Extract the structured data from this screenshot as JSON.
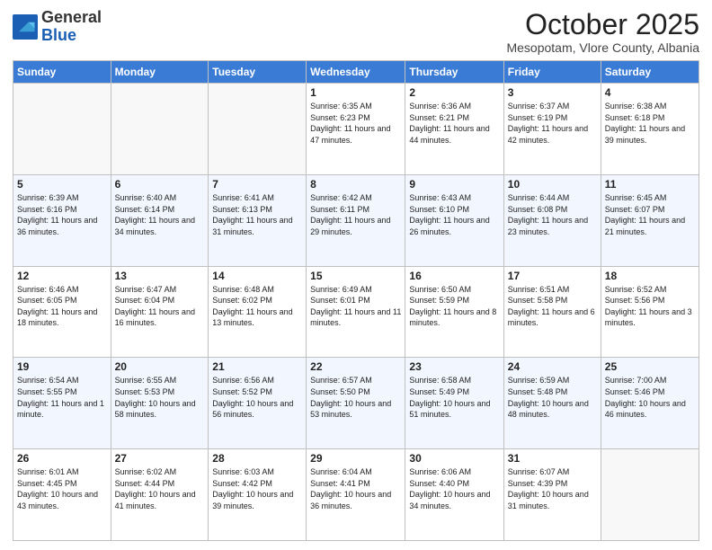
{
  "header": {
    "logo_general": "General",
    "logo_blue": "Blue",
    "month_title": "October 2025",
    "subtitle": "Mesopotam, Vlore County, Albania"
  },
  "days_of_week": [
    "Sunday",
    "Monday",
    "Tuesday",
    "Wednesday",
    "Thursday",
    "Friday",
    "Saturday"
  ],
  "weeks": [
    [
      {
        "day": "",
        "info": ""
      },
      {
        "day": "",
        "info": ""
      },
      {
        "day": "",
        "info": ""
      },
      {
        "day": "1",
        "info": "Sunrise: 6:35 AM\nSunset: 6:23 PM\nDaylight: 11 hours and 47 minutes."
      },
      {
        "day": "2",
        "info": "Sunrise: 6:36 AM\nSunset: 6:21 PM\nDaylight: 11 hours and 44 minutes."
      },
      {
        "day": "3",
        "info": "Sunrise: 6:37 AM\nSunset: 6:19 PM\nDaylight: 11 hours and 42 minutes."
      },
      {
        "day": "4",
        "info": "Sunrise: 6:38 AM\nSunset: 6:18 PM\nDaylight: 11 hours and 39 minutes."
      }
    ],
    [
      {
        "day": "5",
        "info": "Sunrise: 6:39 AM\nSunset: 6:16 PM\nDaylight: 11 hours and 36 minutes."
      },
      {
        "day": "6",
        "info": "Sunrise: 6:40 AM\nSunset: 6:14 PM\nDaylight: 11 hours and 34 minutes."
      },
      {
        "day": "7",
        "info": "Sunrise: 6:41 AM\nSunset: 6:13 PM\nDaylight: 11 hours and 31 minutes."
      },
      {
        "day": "8",
        "info": "Sunrise: 6:42 AM\nSunset: 6:11 PM\nDaylight: 11 hours and 29 minutes."
      },
      {
        "day": "9",
        "info": "Sunrise: 6:43 AM\nSunset: 6:10 PM\nDaylight: 11 hours and 26 minutes."
      },
      {
        "day": "10",
        "info": "Sunrise: 6:44 AM\nSunset: 6:08 PM\nDaylight: 11 hours and 23 minutes."
      },
      {
        "day": "11",
        "info": "Sunrise: 6:45 AM\nSunset: 6:07 PM\nDaylight: 11 hours and 21 minutes."
      }
    ],
    [
      {
        "day": "12",
        "info": "Sunrise: 6:46 AM\nSunset: 6:05 PM\nDaylight: 11 hours and 18 minutes."
      },
      {
        "day": "13",
        "info": "Sunrise: 6:47 AM\nSunset: 6:04 PM\nDaylight: 11 hours and 16 minutes."
      },
      {
        "day": "14",
        "info": "Sunrise: 6:48 AM\nSunset: 6:02 PM\nDaylight: 11 hours and 13 minutes."
      },
      {
        "day": "15",
        "info": "Sunrise: 6:49 AM\nSunset: 6:01 PM\nDaylight: 11 hours and 11 minutes."
      },
      {
        "day": "16",
        "info": "Sunrise: 6:50 AM\nSunset: 5:59 PM\nDaylight: 11 hours and 8 minutes."
      },
      {
        "day": "17",
        "info": "Sunrise: 6:51 AM\nSunset: 5:58 PM\nDaylight: 11 hours and 6 minutes."
      },
      {
        "day": "18",
        "info": "Sunrise: 6:52 AM\nSunset: 5:56 PM\nDaylight: 11 hours and 3 minutes."
      }
    ],
    [
      {
        "day": "19",
        "info": "Sunrise: 6:54 AM\nSunset: 5:55 PM\nDaylight: 11 hours and 1 minute."
      },
      {
        "day": "20",
        "info": "Sunrise: 6:55 AM\nSunset: 5:53 PM\nDaylight: 10 hours and 58 minutes."
      },
      {
        "day": "21",
        "info": "Sunrise: 6:56 AM\nSunset: 5:52 PM\nDaylight: 10 hours and 56 minutes."
      },
      {
        "day": "22",
        "info": "Sunrise: 6:57 AM\nSunset: 5:50 PM\nDaylight: 10 hours and 53 minutes."
      },
      {
        "day": "23",
        "info": "Sunrise: 6:58 AM\nSunset: 5:49 PM\nDaylight: 10 hours and 51 minutes."
      },
      {
        "day": "24",
        "info": "Sunrise: 6:59 AM\nSunset: 5:48 PM\nDaylight: 10 hours and 48 minutes."
      },
      {
        "day": "25",
        "info": "Sunrise: 7:00 AM\nSunset: 5:46 PM\nDaylight: 10 hours and 46 minutes."
      }
    ],
    [
      {
        "day": "26",
        "info": "Sunrise: 6:01 AM\nSunset: 4:45 PM\nDaylight: 10 hours and 43 minutes."
      },
      {
        "day": "27",
        "info": "Sunrise: 6:02 AM\nSunset: 4:44 PM\nDaylight: 10 hours and 41 minutes."
      },
      {
        "day": "28",
        "info": "Sunrise: 6:03 AM\nSunset: 4:42 PM\nDaylight: 10 hours and 39 minutes."
      },
      {
        "day": "29",
        "info": "Sunrise: 6:04 AM\nSunset: 4:41 PM\nDaylight: 10 hours and 36 minutes."
      },
      {
        "day": "30",
        "info": "Sunrise: 6:06 AM\nSunset: 4:40 PM\nDaylight: 10 hours and 34 minutes."
      },
      {
        "day": "31",
        "info": "Sunrise: 6:07 AM\nSunset: 4:39 PM\nDaylight: 10 hours and 31 minutes."
      },
      {
        "day": "",
        "info": ""
      }
    ]
  ]
}
